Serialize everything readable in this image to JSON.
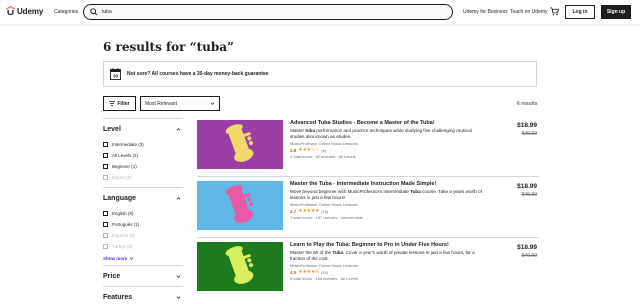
{
  "header": {
    "logo_text": "Udemy",
    "categories_label": "Categories",
    "search_value": "tuba",
    "business_label": "Udemy for Business",
    "teach_label": "Teach on Udemy",
    "login_label": "Log in",
    "signup_label": "Sign up"
  },
  "page": {
    "title": "6 results for “tuba”",
    "banner_text": "Not sure? All courses have a 30-day money-back guarantee",
    "calendar_day": "30",
    "filter_label": "Filter",
    "sort_value": "Most Relevant",
    "results_count": "6 results"
  },
  "sidebar": {
    "level": {
      "title": "Level",
      "options": [
        {
          "label": "Intermediate",
          "count": "(3)",
          "disabled": false
        },
        {
          "label": "All Levels",
          "count": "(2)",
          "disabled": false
        },
        {
          "label": "Beginner",
          "count": "(1)",
          "disabled": false
        },
        {
          "label": "Expert",
          "count": "(0)",
          "disabled": true
        }
      ]
    },
    "language": {
      "title": "Language",
      "options": [
        {
          "label": "English",
          "count": "(5)",
          "disabled": false
        },
        {
          "label": "Português",
          "count": "(1)",
          "disabled": false
        },
        {
          "label": "Español",
          "count": "(0)",
          "disabled": true
        },
        {
          "label": "Türkçe",
          "count": "(0)",
          "disabled": true
        }
      ],
      "show_more": "Show more"
    },
    "price_title": "Price",
    "features_title": "Features"
  },
  "courses": [
    {
      "title": "Advanced Tuba Studies - Become a Master of the Tuba!",
      "description": "Master tuba performance and practice techniques while studying five challenging musical studies also known as etudes.",
      "author": "MusicProfessor Online Music Lessons",
      "rating": "2.8",
      "stars": "★★★☆☆",
      "rating_count": "(4)",
      "meta": "4 total hours · 62 lectures · All Levels",
      "price": "$18.99",
      "old_price": "$49.99",
      "thumb_bg": "#9b3fa6",
      "tuba_color": "#f3d86b"
    },
    {
      "title": "Master the Tuba - Intermediate Instruction Made Simple!",
      "description": "Move beyond beginner with MusicProfessor's intermediate Tuba course. Take a years worth of lessons in just a few hours!",
      "author": "MusicProfessor Online Music Lessons",
      "rating": "4.7",
      "stars": "★★★★★",
      "rating_count": "(16)",
      "meta": "7 total hours · 107 lectures · Intermediate",
      "price": "$18.99",
      "old_price": "$49.99",
      "thumb_bg": "#5fb8e6",
      "tuba_color": "#e85aa6"
    },
    {
      "title": "Learn to Play the Tuba: Beginner to Pro in Under Five Hours!",
      "description": "Master the art of the Tuba: Cover a year's worth of private lessons in just a few hours, for a fraction of the cost.",
      "author": "MusicProfessor Online Music Lessons",
      "rating": "4.5",
      "stars": "★★★★½",
      "rating_count": "(19)",
      "meta": "5 total hours · 106 lectures · All Levels",
      "price": "$18.99",
      "old_price": "$49.99",
      "thumb_bg": "#1e7a1e",
      "tuba_color": "#d8f060"
    }
  ],
  "colors": {
    "brand": "#a435f0",
    "logo_red": "#ec5252",
    "link_purple": "#5624d0",
    "rating_orange": "#b4690e",
    "star_yellow": "#e59819"
  }
}
